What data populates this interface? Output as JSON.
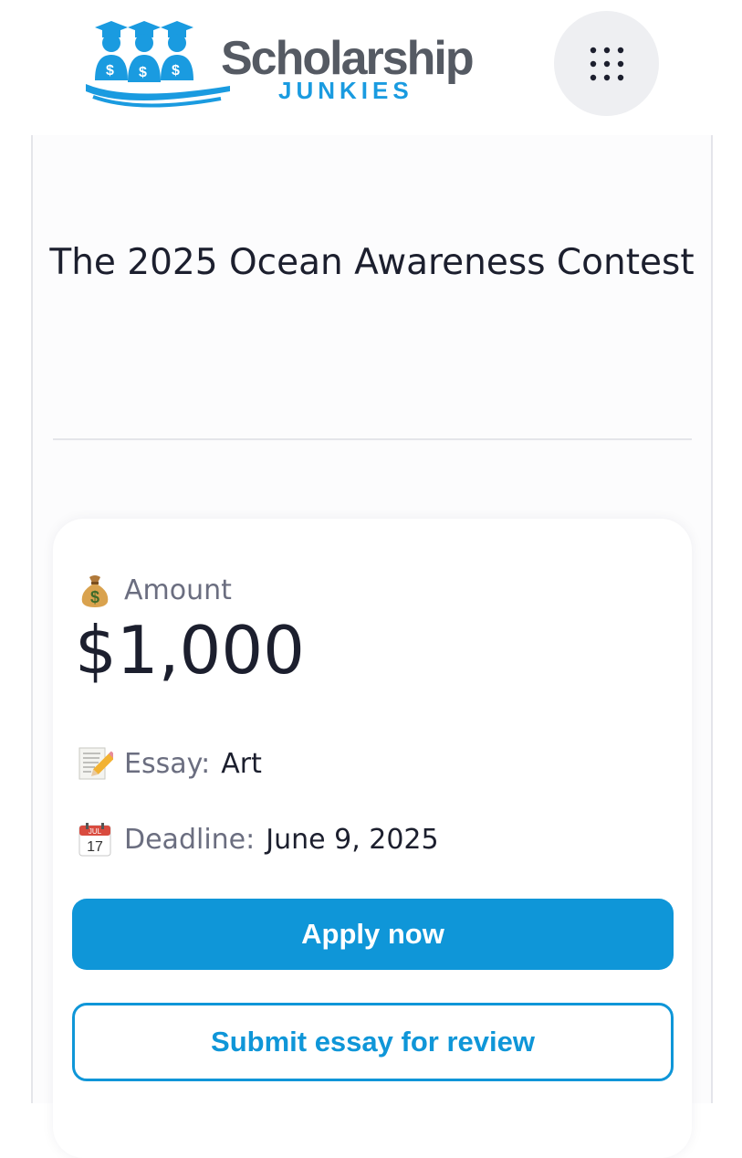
{
  "header": {
    "logo_word": "Scholarship",
    "logo_sub": "JUNKIES",
    "brand_blue": "#1a9be0",
    "brand_gray": "#555a63",
    "menu_icon": "grid-dots-icon"
  },
  "contest": {
    "title": "The 2025 Ocean Awareness Contest"
  },
  "details": {
    "amount_icon": "money-bag-icon",
    "amount_label": "Amount",
    "amount_value": "$1,000",
    "essay_icon": "memo-pencil-icon",
    "essay_label": "Essay:",
    "essay_value": "Art",
    "deadline_icon": "calendar-icon",
    "deadline_label": "Deadline:",
    "deadline_value": "June 9, 2025",
    "calendar_month": "JUL",
    "calendar_day": "17"
  },
  "actions": {
    "apply_label": "Apply now",
    "review_label": "Submit essay for review",
    "accent": "#0f96d8"
  }
}
